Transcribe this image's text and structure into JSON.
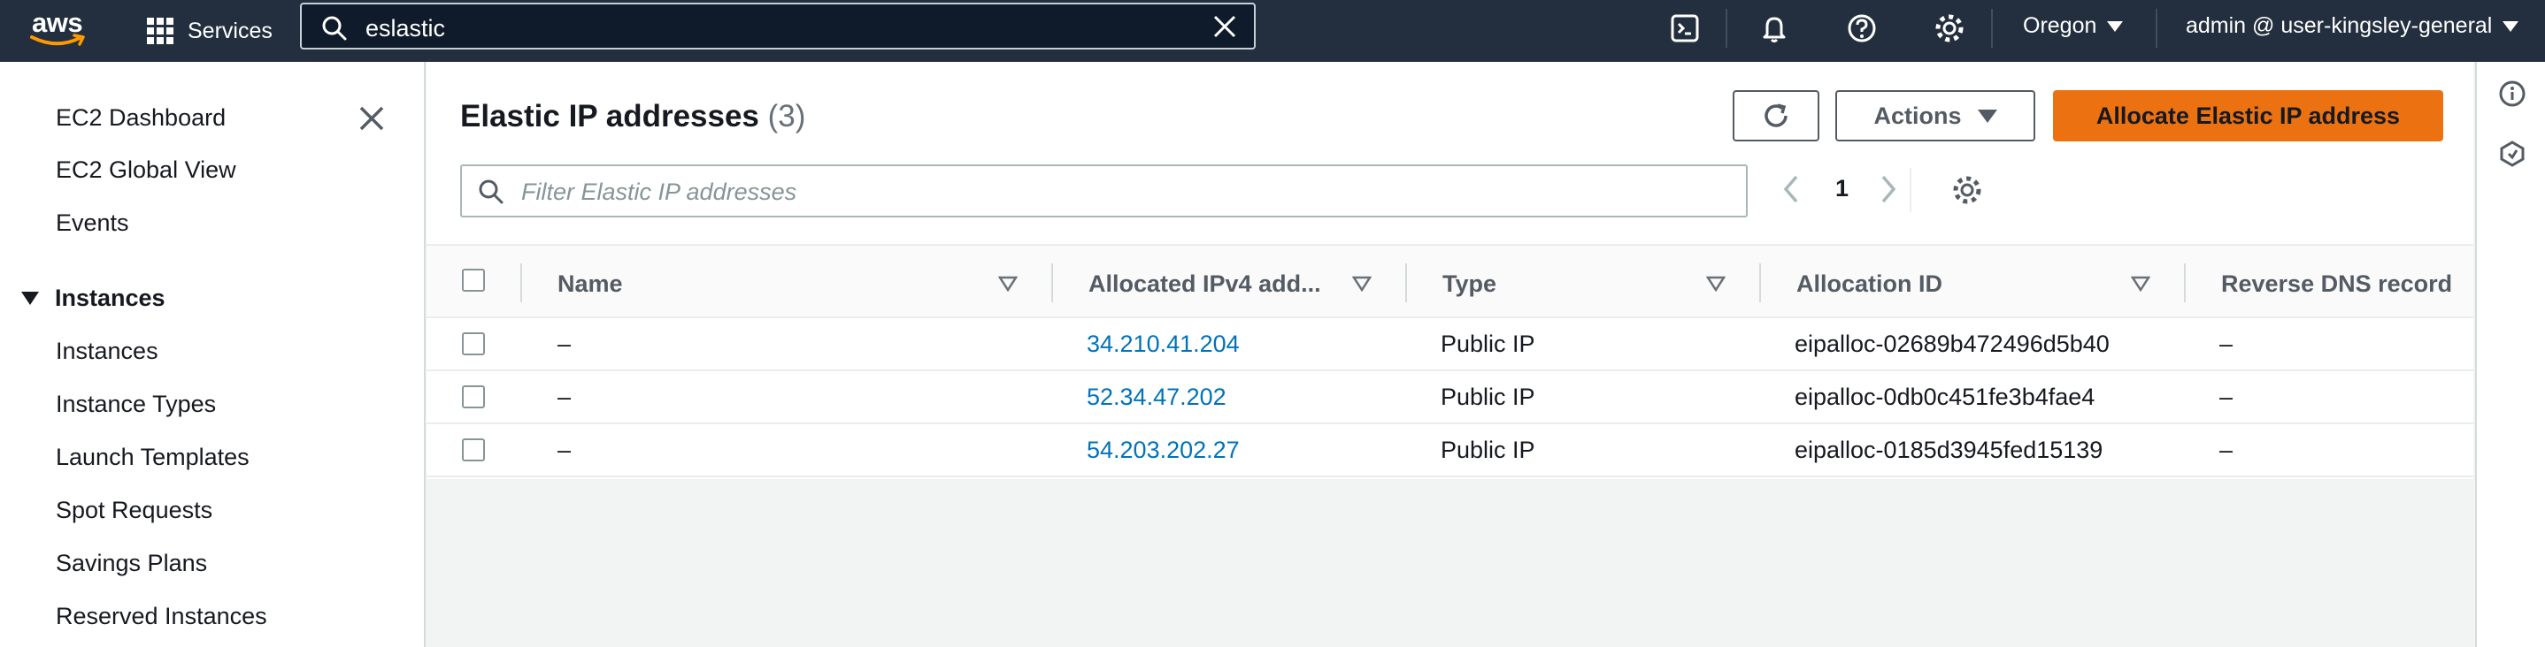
{
  "topnav": {
    "logo_text": "aws",
    "services_label": "Services",
    "search_value": "eslastic",
    "region": "Oregon",
    "account": "admin @ user-kingsley-general",
    "icons": [
      "cloudshell-icon",
      "notifications-bell-icon",
      "help-icon",
      "settings-gear-icon"
    ]
  },
  "sidebar": {
    "items_top": [
      {
        "label": "EC2 Dashboard"
      },
      {
        "label": "EC2 Global View"
      },
      {
        "label": "Events"
      }
    ],
    "section": {
      "label": "Instances"
    },
    "items_section": [
      {
        "label": "Instances"
      },
      {
        "label": "Instance Types"
      },
      {
        "label": "Launch Templates"
      },
      {
        "label": "Spot Requests"
      },
      {
        "label": "Savings Plans"
      },
      {
        "label": "Reserved Instances"
      }
    ]
  },
  "main": {
    "title": "Elastic IP addresses",
    "count": "(3)",
    "actions_label": "Actions",
    "primary_label": "Allocate Elastic IP address",
    "filter_placeholder": "Filter Elastic IP addresses",
    "page_number": "1",
    "columns": [
      "Name",
      "Allocated IPv4 add...",
      "Type",
      "Allocation ID",
      "Reverse DNS record"
    ],
    "rows": [
      {
        "name": "–",
        "ip": "34.210.41.204",
        "type": "Public IP",
        "allocation_id": "eipalloc-02689b472496d5b40",
        "rdns": "–"
      },
      {
        "name": "–",
        "ip": "52.34.47.202",
        "type": "Public IP",
        "allocation_id": "eipalloc-0db0c451fe3b4fae4",
        "rdns": "–"
      },
      {
        "name": "–",
        "ip": "54.203.202.27",
        "type": "Public IP",
        "allocation_id": "eipalloc-0185d3945fed15139",
        "rdns": "–"
      }
    ]
  },
  "colors": {
    "topnav_bg": "#232f3e",
    "primary_button": "#ec7211",
    "link": "#0073bb",
    "page_bg": "#f2f3f3"
  }
}
